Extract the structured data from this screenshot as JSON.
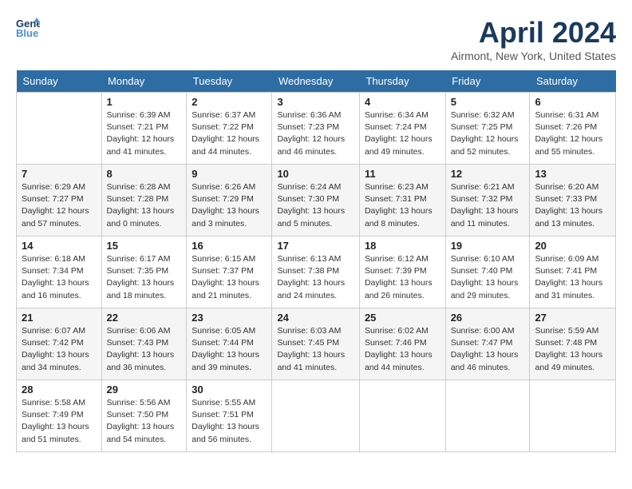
{
  "header": {
    "logo_line1": "General",
    "logo_line2": "Blue",
    "month_title": "April 2024",
    "location": "Airmont, New York, United States"
  },
  "weekdays": [
    "Sunday",
    "Monday",
    "Tuesday",
    "Wednesday",
    "Thursday",
    "Friday",
    "Saturday"
  ],
  "weeks": [
    [
      {
        "day": "",
        "info": ""
      },
      {
        "day": "1",
        "info": "Sunrise: 6:39 AM\nSunset: 7:21 PM\nDaylight: 12 hours\nand 41 minutes."
      },
      {
        "day": "2",
        "info": "Sunrise: 6:37 AM\nSunset: 7:22 PM\nDaylight: 12 hours\nand 44 minutes."
      },
      {
        "day": "3",
        "info": "Sunrise: 6:36 AM\nSunset: 7:23 PM\nDaylight: 12 hours\nand 46 minutes."
      },
      {
        "day": "4",
        "info": "Sunrise: 6:34 AM\nSunset: 7:24 PM\nDaylight: 12 hours\nand 49 minutes."
      },
      {
        "day": "5",
        "info": "Sunrise: 6:32 AM\nSunset: 7:25 PM\nDaylight: 12 hours\nand 52 minutes."
      },
      {
        "day": "6",
        "info": "Sunrise: 6:31 AM\nSunset: 7:26 PM\nDaylight: 12 hours\nand 55 minutes."
      }
    ],
    [
      {
        "day": "7",
        "info": "Sunrise: 6:29 AM\nSunset: 7:27 PM\nDaylight: 12 hours\nand 57 minutes."
      },
      {
        "day": "8",
        "info": "Sunrise: 6:28 AM\nSunset: 7:28 PM\nDaylight: 13 hours\nand 0 minutes."
      },
      {
        "day": "9",
        "info": "Sunrise: 6:26 AM\nSunset: 7:29 PM\nDaylight: 13 hours\nand 3 minutes."
      },
      {
        "day": "10",
        "info": "Sunrise: 6:24 AM\nSunset: 7:30 PM\nDaylight: 13 hours\nand 5 minutes."
      },
      {
        "day": "11",
        "info": "Sunrise: 6:23 AM\nSunset: 7:31 PM\nDaylight: 13 hours\nand 8 minutes."
      },
      {
        "day": "12",
        "info": "Sunrise: 6:21 AM\nSunset: 7:32 PM\nDaylight: 13 hours\nand 11 minutes."
      },
      {
        "day": "13",
        "info": "Sunrise: 6:20 AM\nSunset: 7:33 PM\nDaylight: 13 hours\nand 13 minutes."
      }
    ],
    [
      {
        "day": "14",
        "info": "Sunrise: 6:18 AM\nSunset: 7:34 PM\nDaylight: 13 hours\nand 16 minutes."
      },
      {
        "day": "15",
        "info": "Sunrise: 6:17 AM\nSunset: 7:35 PM\nDaylight: 13 hours\nand 18 minutes."
      },
      {
        "day": "16",
        "info": "Sunrise: 6:15 AM\nSunset: 7:37 PM\nDaylight: 13 hours\nand 21 minutes."
      },
      {
        "day": "17",
        "info": "Sunrise: 6:13 AM\nSunset: 7:38 PM\nDaylight: 13 hours\nand 24 minutes."
      },
      {
        "day": "18",
        "info": "Sunrise: 6:12 AM\nSunset: 7:39 PM\nDaylight: 13 hours\nand 26 minutes."
      },
      {
        "day": "19",
        "info": "Sunrise: 6:10 AM\nSunset: 7:40 PM\nDaylight: 13 hours\nand 29 minutes."
      },
      {
        "day": "20",
        "info": "Sunrise: 6:09 AM\nSunset: 7:41 PM\nDaylight: 13 hours\nand 31 minutes."
      }
    ],
    [
      {
        "day": "21",
        "info": "Sunrise: 6:07 AM\nSunset: 7:42 PM\nDaylight: 13 hours\nand 34 minutes."
      },
      {
        "day": "22",
        "info": "Sunrise: 6:06 AM\nSunset: 7:43 PM\nDaylight: 13 hours\nand 36 minutes."
      },
      {
        "day": "23",
        "info": "Sunrise: 6:05 AM\nSunset: 7:44 PM\nDaylight: 13 hours\nand 39 minutes."
      },
      {
        "day": "24",
        "info": "Sunrise: 6:03 AM\nSunset: 7:45 PM\nDaylight: 13 hours\nand 41 minutes."
      },
      {
        "day": "25",
        "info": "Sunrise: 6:02 AM\nSunset: 7:46 PM\nDaylight: 13 hours\nand 44 minutes."
      },
      {
        "day": "26",
        "info": "Sunrise: 6:00 AM\nSunset: 7:47 PM\nDaylight: 13 hours\nand 46 minutes."
      },
      {
        "day": "27",
        "info": "Sunrise: 5:59 AM\nSunset: 7:48 PM\nDaylight: 13 hours\nand 49 minutes."
      }
    ],
    [
      {
        "day": "28",
        "info": "Sunrise: 5:58 AM\nSunset: 7:49 PM\nDaylight: 13 hours\nand 51 minutes."
      },
      {
        "day": "29",
        "info": "Sunrise: 5:56 AM\nSunset: 7:50 PM\nDaylight: 13 hours\nand 54 minutes."
      },
      {
        "day": "30",
        "info": "Sunrise: 5:55 AM\nSunset: 7:51 PM\nDaylight: 13 hours\nand 56 minutes."
      },
      {
        "day": "",
        "info": ""
      },
      {
        "day": "",
        "info": ""
      },
      {
        "day": "",
        "info": ""
      },
      {
        "day": "",
        "info": ""
      }
    ]
  ]
}
